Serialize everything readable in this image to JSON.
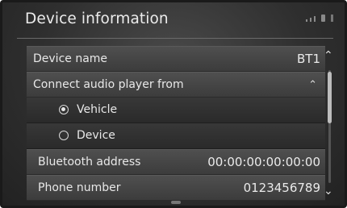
{
  "header": {
    "title": "Device information",
    "status_icons": [
      "signal-bars-icon",
      "phone-battery-icon",
      "bluetooth-icon"
    ]
  },
  "rows": [
    {
      "label": "Device name",
      "value": "BT1"
    },
    {
      "label": "Connect audio player from",
      "expanded": true
    },
    {
      "label": "Vehicle",
      "selected": true
    },
    {
      "label": "Device",
      "selected": false
    },
    {
      "label": "Bluetooth address",
      "value": "00:00:00:00:00:00"
    },
    {
      "label": "Phone number",
      "value": "0123456789"
    }
  ]
}
